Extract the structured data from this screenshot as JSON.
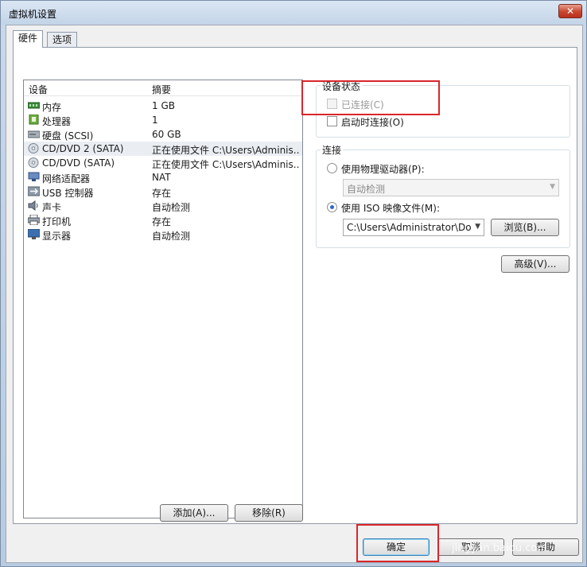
{
  "window": {
    "title": "虚拟机设置",
    "close_symbol": "✕"
  },
  "tabs": [
    {
      "label": "硬件",
      "active": true
    },
    {
      "label": "选项",
      "active": false
    }
  ],
  "device_list": {
    "col_device": "设备",
    "col_summary": "摘要",
    "rows": [
      {
        "icon": "memory-icon",
        "name": "内存",
        "summary": "1 GB"
      },
      {
        "icon": "processor-icon",
        "name": "处理器",
        "summary": "1"
      },
      {
        "icon": "hard-disk-icon",
        "name": "硬盘 (SCSI)",
        "summary": "60 GB"
      },
      {
        "icon": "cd-dvd-icon",
        "name": "CD/DVD 2 (SATA)",
        "summary": "正在使用文件 C:\\Users\\Adminis...",
        "selected": true
      },
      {
        "icon": "cd-dvd-icon",
        "name": "CD/DVD (SATA)",
        "summary": "正在使用文件 C:\\Users\\Adminis..."
      },
      {
        "icon": "network-adapter-icon",
        "name": "网络适配器",
        "summary": "NAT"
      },
      {
        "icon": "usb-icon",
        "name": "USB 控制器",
        "summary": "存在"
      },
      {
        "icon": "sound-card-icon",
        "name": "声卡",
        "summary": "自动检测"
      },
      {
        "icon": "printer-icon",
        "name": "打印机",
        "summary": "存在"
      },
      {
        "icon": "display-icon",
        "name": "显示器",
        "summary": "自动检测"
      }
    ]
  },
  "buttons": {
    "add": "添加(A)...",
    "remove": "移除(R)",
    "browse": "浏览(B)...",
    "advanced": "高级(V)...",
    "ok": "确定",
    "cancel": "取消",
    "help": "帮助"
  },
  "device_status": {
    "title": "设备状态",
    "connected": "已连接(C)",
    "connect_at_power_on": "启动时连接(O)"
  },
  "connection": {
    "title": "连接",
    "physical_drive": "使用物理驱动器(P):",
    "physical_drive_value": "自动检测",
    "iso_image": "使用 ISO 映像文件(M):",
    "iso_path": "C:\\Users\\Administrator\\Dow"
  },
  "watermark": "jingyan.baidu.com",
  "colors": {
    "highlight_box": "#d9262b",
    "radio_selected": "#2a6ad0"
  }
}
